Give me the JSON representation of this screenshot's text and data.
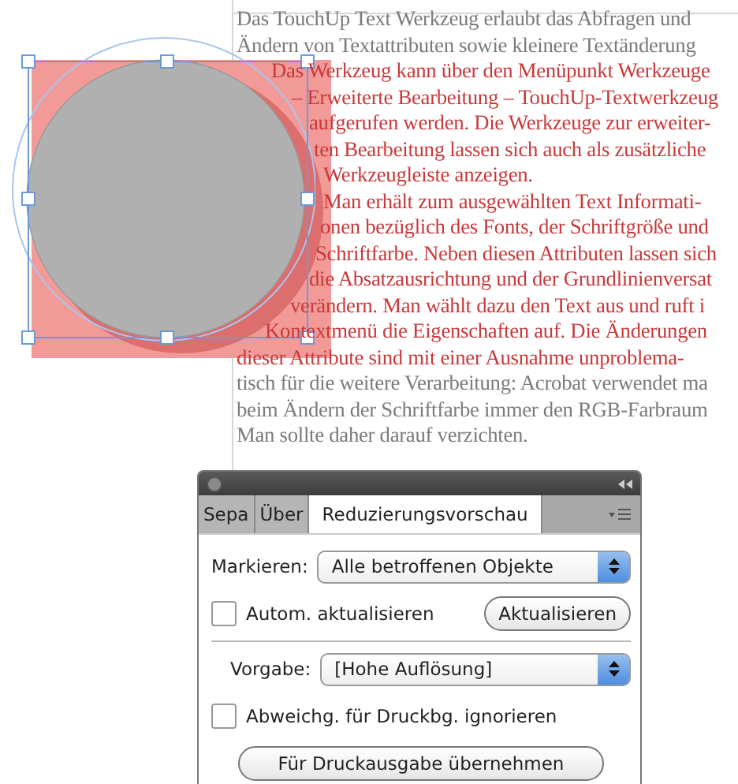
{
  "document": {
    "lines": [
      {
        "text": "Das TouchUp Text Werkzeug erlaubt das Abfragen und",
        "highlighted": false
      },
      {
        "text": "Ändern von Textattributen sowie kleinere Textänderung",
        "highlighted": false
      },
      {
        "text": "Das Werkzeug kann über den Menüpunkt Werkzeuge",
        "highlighted": true
      },
      {
        "text": "– Erweiterte Bearbeitung – TouchUp-Textwerkzeug",
        "highlighted": true
      },
      {
        "text": "aufgerufen werden. Die Werkzeuge zur erweiter-",
        "highlighted": true
      },
      {
        "text": "ten Bearbeitung lassen sich auch als zusätzliche",
        "highlighted": true
      },
      {
        "text": "Werkzeugleiste anzeigen.",
        "highlighted": true
      },
      {
        "text": "Man erhält zum ausgewählten Text Informati-",
        "highlighted": true
      },
      {
        "text": "onen bezüglich des Fonts, der Schriftgröße und",
        "highlighted": true
      },
      {
        "text": "Schriftfarbe. Neben diesen Attributen lassen sich",
        "highlighted": true
      },
      {
        "text": "die Absatzausrichtung und der Grundlinienversat",
        "highlighted": true
      },
      {
        "text": "verändern. Man wählt dazu den Text aus und ruft i",
        "highlighted": true
      },
      {
        "text": "Kontextmenü die Eigenschaften auf. Die Änderungen",
        "highlighted": true
      },
      {
        "text": "dieser Attribute sind mit einer Ausnahme unproblema-",
        "highlighted": true
      },
      {
        "text": "tisch für die weitere Verarbeitung: Acrobat verwendet ma",
        "highlighted": false
      },
      {
        "text": "beim Ändern der Schriftfarbe immer den RGB-Farbraum",
        "highlighted": false
      },
      {
        "text": "Man sollte daher darauf verzichten.",
        "highlighted": false
      }
    ]
  },
  "panel": {
    "tabs": [
      {
        "label": "Sepa",
        "selected": false
      },
      {
        "label": "Über",
        "selected": false
      },
      {
        "label": "Reduzierungsvorschau",
        "selected": true
      }
    ],
    "markieren": {
      "label": "Markieren:",
      "value": "Alle betroffenen Objekte"
    },
    "auto_update": {
      "label": "Autom. aktualisieren",
      "checked": false
    },
    "update_button": "Aktualisieren",
    "vorgabe": {
      "label": "Vorgabe:",
      "value": "[Hohe Auflösung]"
    },
    "ignore_overrides": {
      "label": "Abweichg. für Druckbg. ignorieren",
      "checked": false
    },
    "apply_button": "Für Druckausgabe übernehmen"
  }
}
